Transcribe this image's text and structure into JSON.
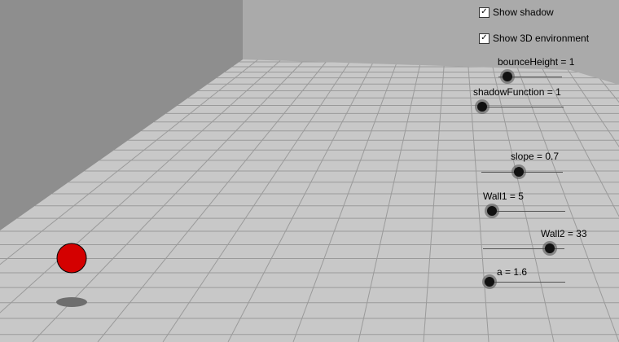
{
  "checkboxes": {
    "show_shadow": {
      "label": "Show shadow",
      "checked": true
    },
    "show_3d": {
      "label": "Show 3D environment",
      "checked": true
    }
  },
  "sliders": {
    "bounce_height": {
      "label": "bounceHeight = 1"
    },
    "shadow_function": {
      "label": "shadowFunction = 1"
    },
    "slope": {
      "label": "slope = 0.7"
    },
    "wall1": {
      "label": "Wall1 = 5"
    },
    "wall2": {
      "label": "Wall2 = 33"
    },
    "a": {
      "label": "a = 1.6"
    }
  },
  "colors": {
    "ball": "#d40000",
    "shadow": "#6e6e6e",
    "floor": "#c8c8c8",
    "left_wall": "#8e8e8e",
    "back_wall": "#aaaaaa",
    "grid": "#9a9a9a"
  }
}
